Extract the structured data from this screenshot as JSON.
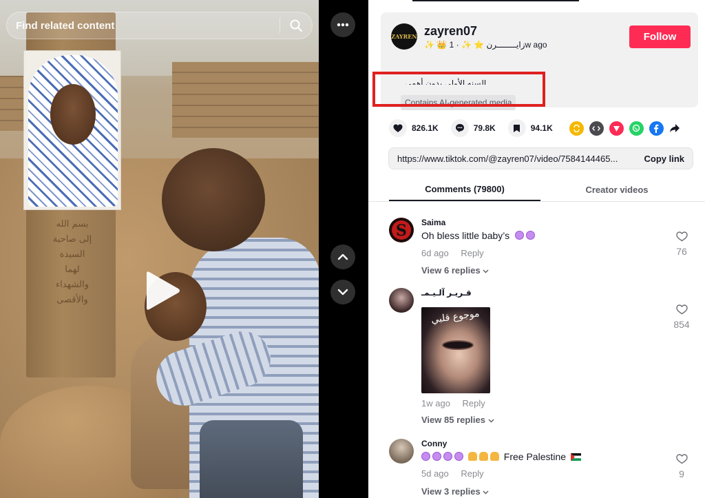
{
  "search": {
    "placeholder": "Find related content"
  },
  "video": {
    "post_inscription": [
      "بسم الله",
      "إلى صاحبة",
      "السيدة",
      "لهما",
      "والشهداء",
      "والأقصى"
    ]
  },
  "author": {
    "username": "zayren07",
    "avatar_text": "ZAYREN",
    "display_name": "✨ 👑 زايــــــــرن ⭐ ✨",
    "posted": "· 1w ago",
    "follow_label": "Follow",
    "description": "السنه الأولى بدون أهمي",
    "ai_label": "Contains AI-generated media"
  },
  "actions": {
    "likes": "826.1K",
    "comments": "79.8K",
    "saves": "94.1K"
  },
  "share": {
    "url": "https://www.tiktok.com/@zayren07/video/7584144465...",
    "copy_label": "Copy link"
  },
  "tabs": {
    "comments": "Comments (79800)",
    "creator": "Creator videos"
  },
  "comments": [
    {
      "name": "Saima",
      "text": "Oh bless little baby’s",
      "age": "6d ago",
      "reply": "Reply",
      "replies": "View 6 replies",
      "likes": "76"
    },
    {
      "name": "قـريـر آلـيـمـ",
      "text": "",
      "age": "1w ago",
      "reply": "Reply",
      "replies": "View 85 replies",
      "likes": "854",
      "sticker_text": "موجوع قلبي"
    },
    {
      "name": "Conny",
      "text": "Free Palestine",
      "age": "5d ago",
      "reply": "Reply",
      "replies": "View 3 replies",
      "likes": "9"
    }
  ],
  "colors": {
    "follow": "#fe2c55",
    "highlight_box": "#e02020",
    "repost": "#f5b800",
    "embed": "#4b4b4f",
    "send": "#fe2c55",
    "whatsapp": "#25d366",
    "facebook": "#1877f2"
  }
}
